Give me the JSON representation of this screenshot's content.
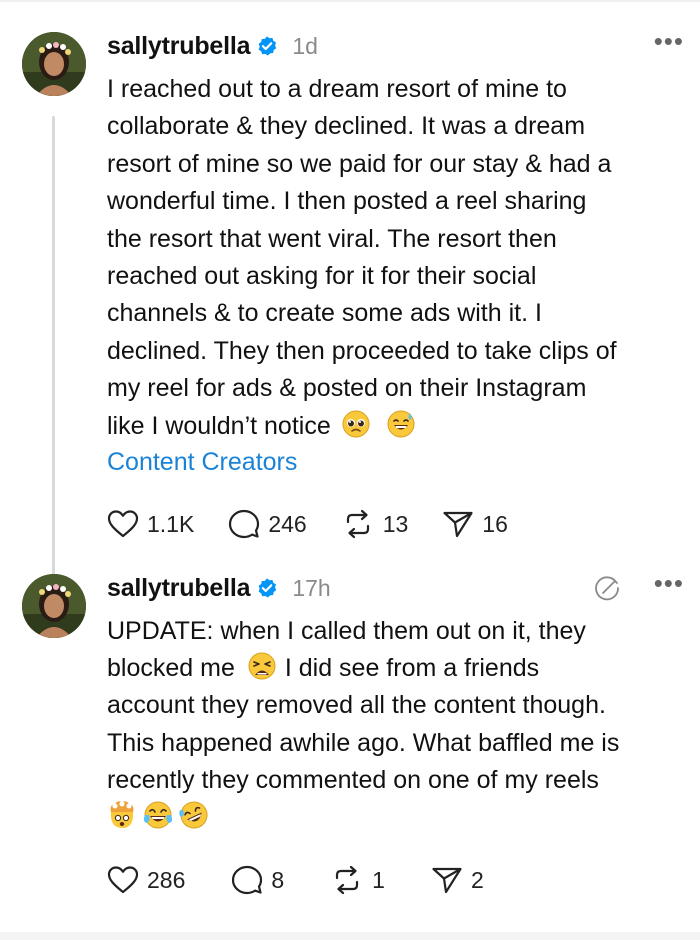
{
  "posts": [
    {
      "username": "sallytrubella",
      "timestamp": "1d",
      "text": "I reached out to a dream resort of mine to\ncollaborate & they declined. It was a dream\nresort of mine so we paid for our stay & had a\nwonderful time. I then posted a reel sharing\nthe resort that went viral. The resort then\nreached out asking for it for their social\nchannels & to create some ads with it. I\ndeclined. They then proceeded to take clips of\nmy reel for ads & posted on their Instagram\nlike I wouldn’t notice",
      "emojis": [
        "pleading-face",
        "sweat-smile"
      ],
      "tag": "Content Creators",
      "likes": "1.1K",
      "replies": "246",
      "reposts": "13",
      "shares": "16"
    },
    {
      "username": "sallytrubella",
      "timestamp": "17h",
      "text_before_emoji": "UPDATE: when I called them out on it, they\nblocked me",
      "text_after_emoji": "I did see from a friends\naccount they removed all the content though.\nThis happened awhile ago. What baffled me is\nrecently they commented on one of my reels",
      "emojis": [
        "weary-face",
        "exploding-head",
        "tears-of-joy",
        "rofl"
      ],
      "likes": "286",
      "replies": "8",
      "reposts": "1",
      "shares": "2"
    }
  ],
  "icons": {
    "verified": "verified-badge-icon",
    "more": "more-options-icon",
    "edited": "edited-icon",
    "like": "heart-icon",
    "reply": "comment-icon",
    "repost": "repost-icon",
    "share": "send-icon"
  },
  "colors": {
    "link": "#1a83d8",
    "verified": "#0095f6",
    "muted": "#8a8a8a"
  }
}
